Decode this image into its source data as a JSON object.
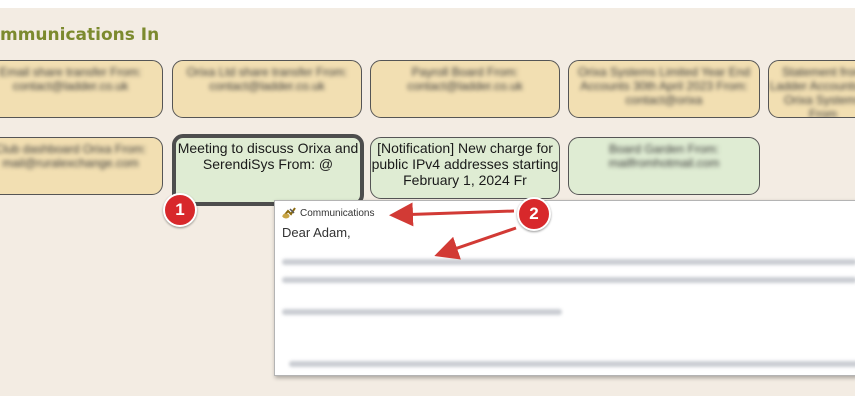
{
  "section": {
    "title": "mmunications In"
  },
  "cards_row1": [
    {
      "text": "Email share transfer From: contact@ladder.co.uk",
      "color": "tan"
    },
    {
      "text": "Orixa Ltd share transfer From: contact@ladder.co.uk",
      "color": "tan"
    },
    {
      "text": "Payroll Board From: contact@ladder.co.uk",
      "color": "tan"
    },
    {
      "text": "Orixa Systems Limited Year End Accounts 30th April 2023 From: contact@orixa",
      "color": "tan"
    },
    {
      "text": "Statement from Ladder Accounts for Orixa Systems From",
      "color": "tan"
    }
  ],
  "cards_row2": [
    {
      "text": "Club dashboard Orixa From: mail@ruralexchange.com",
      "color": "tan"
    },
    {
      "text": "Meeting to discuss Orixa and SerendiSys From: @",
      "color": "green",
      "selected": true
    },
    {
      "text": "[Notification] New charge for public IPv4 addresses starting February 1, 2024 Fr",
      "color": "green"
    },
    {
      "text": "Board Garden From: mailfromhotmail.com",
      "color": "green"
    }
  ],
  "badges": {
    "one": "1",
    "two": "2"
  },
  "tooltip": {
    "header_label": "Communications",
    "greeting": "Dear Adam,"
  },
  "colors": {
    "accent_title": "#7c8a2e",
    "badge": "#d8282b",
    "arrow": "#d23a35"
  }
}
